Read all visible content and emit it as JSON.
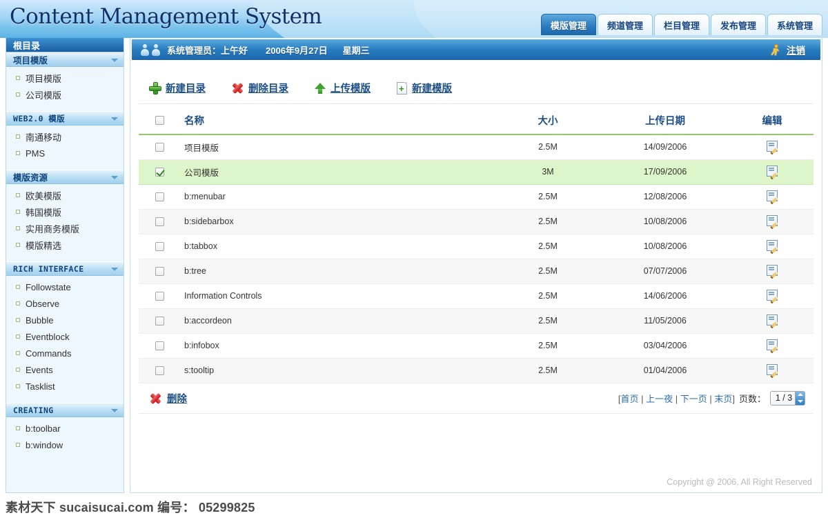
{
  "app": {
    "logo_text": "Content Management System",
    "copyright": "Copyright @ 2006, All Right Reserved",
    "watermark": "素材天下 sucaisucai.com  编号： 05299825",
    "accent_blue": "#1d68ac",
    "accent_green": "#9bc46f",
    "selected_row_bg": "#ddf5c8"
  },
  "tabs": [
    {
      "label": "模版管理",
      "active": true
    },
    {
      "label": "频道管理",
      "active": false
    },
    {
      "label": "栏目管理",
      "active": false
    },
    {
      "label": "发布管理",
      "active": false
    },
    {
      "label": "系统管理",
      "active": false
    }
  ],
  "userbar": {
    "user_icon": "two-people-icon",
    "greeting": "系统管理员：上午好",
    "date": "2006年9月27日",
    "weekday": "星期三",
    "logout_icon": "running-person-icon",
    "logout_label": "注销"
  },
  "sidebar": {
    "root_label": "根目录",
    "sections": [
      {
        "title": "项目模版",
        "mono": false,
        "items": [
          "项目模版",
          "公司模版"
        ]
      },
      {
        "title": "WEB2.0 模版",
        "mono": true,
        "items": [
          "南通移动",
          "PMS"
        ]
      },
      {
        "title": "模版资源",
        "mono": false,
        "items": [
          "欧美模版",
          "韩国模版",
          "实用商务模版",
          "模版精选"
        ]
      },
      {
        "title": "RICH INTERFACE",
        "mono": true,
        "items": [
          "Followstate",
          "Observe",
          "Bubble",
          "Eventblock",
          "Commands",
          "Events",
          "Tasklist"
        ]
      },
      {
        "title": "CREATING",
        "mono": true,
        "items": [
          "b:toolbar",
          "b:window"
        ]
      }
    ]
  },
  "toolbar": [
    {
      "icon": "green-plus-icon",
      "label": "新建目录"
    },
    {
      "icon": "red-cross-icon",
      "label": "删除目录"
    },
    {
      "icon": "green-up-arrow-icon",
      "label": "上传模版"
    },
    {
      "icon": "new-document-icon",
      "label": "新建模版"
    }
  ],
  "table": {
    "headers": {
      "checkbox": "",
      "name": "名称",
      "size": "大小",
      "date": "上传日期",
      "edit": "编辑"
    },
    "rows": [
      {
        "checked": false,
        "name": "项目模版",
        "size": "2.5M",
        "date": "14/09/2006"
      },
      {
        "checked": true,
        "name": "公司模版",
        "size": "3M",
        "date": "17/09/2006"
      },
      {
        "checked": false,
        "name": "b:menubar",
        "size": "2.5M",
        "date": "12/08/2006"
      },
      {
        "checked": false,
        "name": "b:sidebarbox",
        "size": "2.5M",
        "date": "10/08/2006"
      },
      {
        "checked": false,
        "name": "b:tabbox",
        "size": "2.5M",
        "date": "10/08/2006"
      },
      {
        "checked": false,
        "name": "b:tree",
        "size": "2.5M",
        "date": "07/07/2006"
      },
      {
        "checked": false,
        "name": "Information Controls",
        "size": "2.5M",
        "date": "14/06/2006"
      },
      {
        "checked": false,
        "name": "b:accordeon",
        "size": "2.5M",
        "date": "11/05/2006"
      },
      {
        "checked": false,
        "name": "b:infobox",
        "size": "2.5M",
        "date": "03/04/2006"
      },
      {
        "checked": false,
        "name": "s:tooltip",
        "size": "2.5M",
        "date": "01/04/2006"
      }
    ]
  },
  "footer": {
    "delete_icon": "red-cross-icon",
    "delete_label": "删除",
    "pager_open": "[",
    "first": "首页",
    "prev": "上一夜",
    "next": "下一页",
    "last": "末页",
    "pager_close": "]",
    "sep": "|",
    "page_label": "页数：",
    "page_value": "1 / 3"
  }
}
